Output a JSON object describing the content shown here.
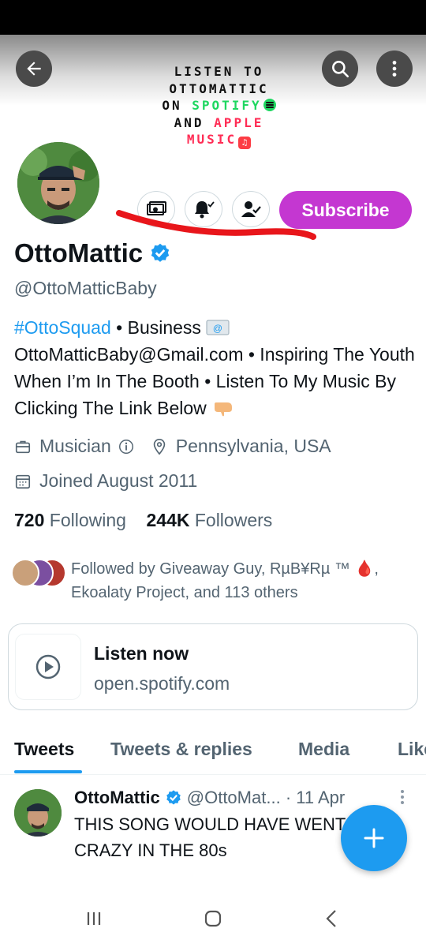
{
  "banner": {
    "line1": "LISTEN TO",
    "line2": "OTTOMATTIC",
    "line3_prefix": "ON ",
    "line3_highlight": "SPOTIFY",
    "line4_prefix": "AND ",
    "line4_highlight": "APPLE",
    "line5_highlight": "MUSIC",
    "spotify_color": "#1ed760",
    "apple_color": "#ff2d55"
  },
  "header_buttons": {
    "back_icon": "arrow-left-icon",
    "search_icon": "search-icon",
    "more_icon": "more-vertical-icon"
  },
  "profile": {
    "display_name": "OttoMattic",
    "handle": "@OttoMatticBaby",
    "verified": true,
    "subscribe_label": "Subscribe",
    "subscribe_color": "#c437d1",
    "bio": {
      "hashtag": "#OttoSquad",
      "part1": " • Business ",
      "part2": "OttoMatticBaby@Gmail.com • Inspiring The Youth When I’m In The Booth • Listen To My Music By Clicking The Link Below "
    },
    "profession": "Musician",
    "location": "Pennsylvania, USA",
    "joined": "Joined August 2011",
    "following_count": "720",
    "following_label": "Following",
    "followers_count": "244K",
    "followers_label": "Followers",
    "followed_by_text": "Followed by Giveaway Guy, RµB¥Rµ ™ 🩸, Ekoalaty Project, and 113 others"
  },
  "link_card": {
    "title": "Listen now",
    "url": "open.spotify.com"
  },
  "tabs": [
    {
      "label": "Tweets",
      "active": true
    },
    {
      "label": "Tweets & replies",
      "active": false
    },
    {
      "label": "Media",
      "active": false
    },
    {
      "label": "Likes",
      "active": false
    }
  ],
  "tweet": {
    "name": "OttoMattic",
    "handle": "@OttoMat...",
    "date": "· 11 Apr",
    "text": "THIS SONG WOULD HAVE WENT CRAZY IN THE 80s"
  },
  "colors": {
    "accent": "#1d9bf0",
    "secondary_text": "#536471",
    "annotation_red": "#e8161b"
  }
}
